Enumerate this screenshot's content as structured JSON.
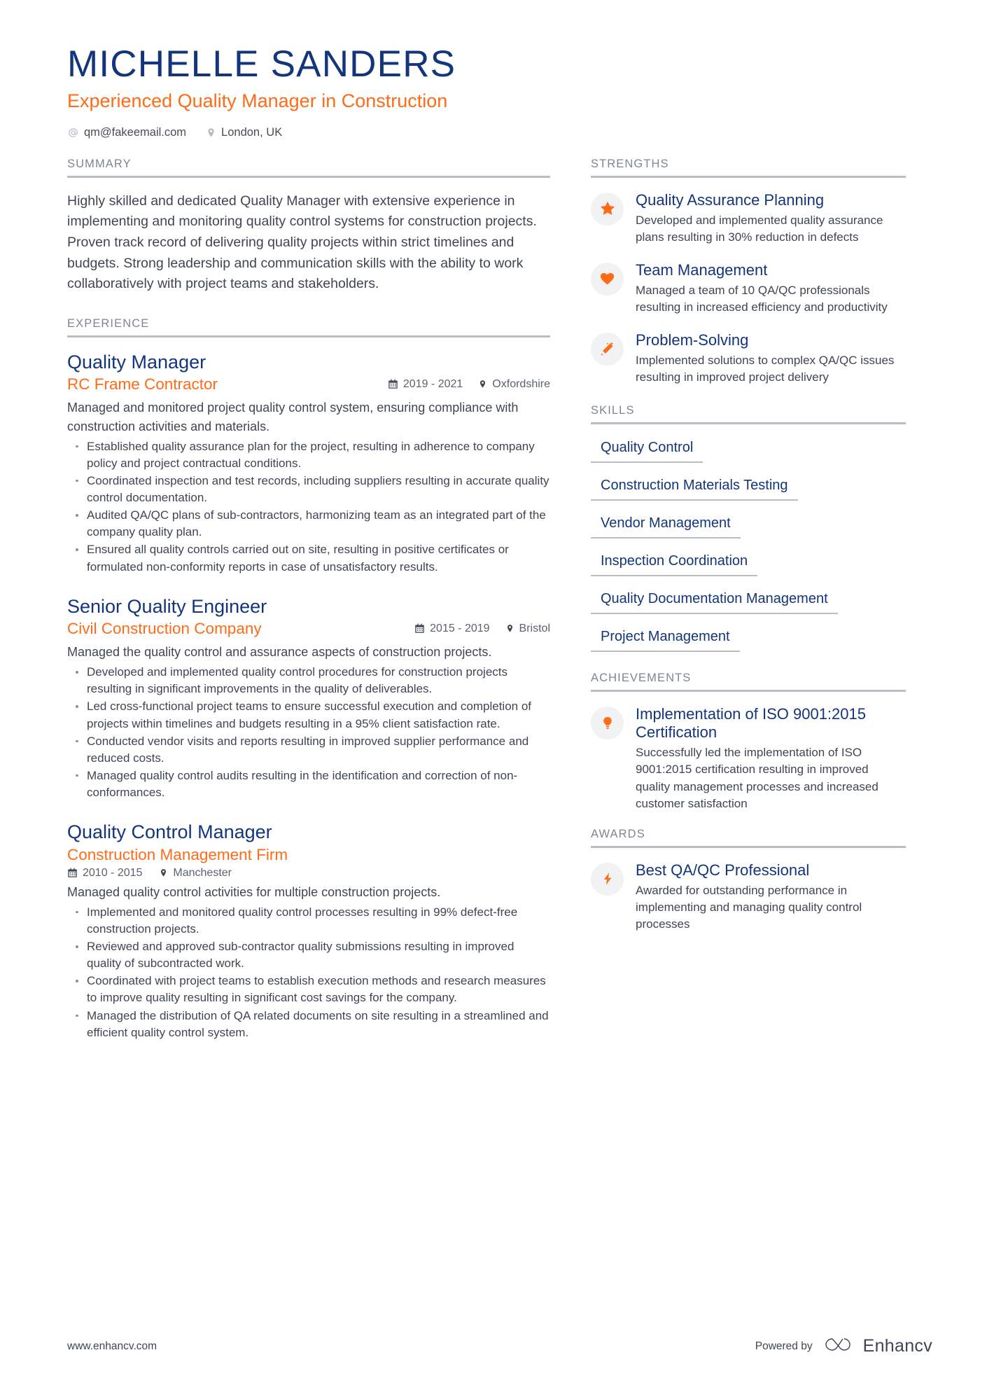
{
  "header": {
    "name": "MICHELLE SANDERS",
    "headline": "Experienced Quality Manager in Construction",
    "contacts": [
      {
        "icon": "at-icon",
        "text": "qm@fakeemail.com"
      },
      {
        "icon": "location-pin-icon",
        "text": "London, UK"
      }
    ]
  },
  "colors": {
    "name_navy": "#12357c",
    "accent_orange": "#ff6b17",
    "body_gray": "#3f4652",
    "rule_gray": "#b9bec5",
    "section_label_gray": "#7e868f",
    "bubble_gray": "#f1f2f3"
  },
  "sections": {
    "summary_title": "SUMMARY",
    "experience_title": "EXPERIENCE",
    "strengths_title": "STRENGTHS",
    "skills_title": "SKILLS",
    "achievements_title": "ACHIEVEMENTS",
    "awards_title": "AWARDS"
  },
  "summary": {
    "text": "Highly skilled and dedicated Quality Manager with extensive experience in implementing and monitoring quality control systems for construction projects. Proven track record of delivering quality projects within strict timelines and budgets. Strong leadership and communication skills with the ability to work collaboratively with project teams and stakeholders."
  },
  "experience": [
    {
      "title": "Quality Manager",
      "company": "RC Frame Contractor",
      "dates": "2019 - 2021",
      "location": "Oxfordshire",
      "meta_inline": true,
      "description": "Managed and monitored project quality control system, ensuring compliance with construction activities and materials.",
      "bullets": [
        "Established quality assurance plan for the project, resulting in adherence to company policy and project contractual conditions.",
        "Coordinated inspection and test records, including suppliers resulting in accurate quality control documentation.",
        "Audited QA/QC plans of sub-contractors, harmonizing team as an integrated part of the company quality plan.",
        "Ensured all quality controls carried out on site, resulting in positive certificates or formulated non-conformity reports in case of unsatisfactory results."
      ]
    },
    {
      "title": "Senior Quality Engineer",
      "company": "Civil Construction Company",
      "dates": "2015 - 2019",
      "location": "Bristol",
      "meta_inline": true,
      "description": "Managed the quality control and assurance aspects of construction projects.",
      "bullets": [
        "Developed and implemented quality control procedures for construction projects resulting in significant improvements in the quality of deliverables.",
        "Led cross-functional project teams to ensure successful execution and completion of projects within timelines and budgets resulting in a 95% client satisfaction rate.",
        "Conducted vendor visits and reports resulting in improved supplier performance and reduced costs.",
        "Managed quality control audits resulting in the identification and correction of non-conformances."
      ]
    },
    {
      "title": "Quality Control Manager",
      "company": "Construction Management Firm",
      "dates": "2010 - 2015",
      "location": "Manchester",
      "meta_inline": false,
      "description": "Managed quality control activities for multiple construction projects.",
      "bullets": [
        "Implemented and monitored quality control processes resulting in 99% defect-free construction projects.",
        "Reviewed and approved sub-contractor quality submissions resulting in improved quality of subcontracted work.",
        "Coordinated with project teams to establish execution methods and research measures to improve quality resulting in significant cost savings for the company.",
        "Managed the distribution of QA related documents on site resulting in a streamlined and efficient quality control system."
      ]
    }
  ],
  "strengths": [
    {
      "icon": "star-icon",
      "title": "Quality Assurance Planning",
      "text": "Developed and implemented quality assurance plans resulting in 30% reduction in defects"
    },
    {
      "icon": "heart-icon",
      "title": "Team Management",
      "text": "Managed a team of 10 QA/QC professionals resulting in increased efficiency and productivity"
    },
    {
      "icon": "magic-wand-icon",
      "title": "Problem-Solving",
      "text": "Implemented solutions to complex QA/QC issues resulting in improved project delivery"
    }
  ],
  "skills": [
    "Quality Control",
    "Construction Materials Testing",
    "Vendor Management",
    "Inspection Coordination",
    "Quality Documentation Management",
    "Project Management"
  ],
  "achievements": [
    {
      "icon": "lightbulb-icon",
      "title": "Implementation of ISO 9001:2015 Certification",
      "text": "Successfully led the implementation of ISO 9001:2015 certification resulting in improved quality management processes and increased customer satisfaction"
    }
  ],
  "awards": [
    {
      "icon": "lightning-bolt-icon",
      "title": "Best QA/QC Professional",
      "text": "Awarded for outstanding performance in implementing and managing quality control processes"
    }
  ],
  "footer": {
    "website": "www.enhancv.com",
    "powered_by": "Powered by",
    "brand": "Enhancv"
  }
}
